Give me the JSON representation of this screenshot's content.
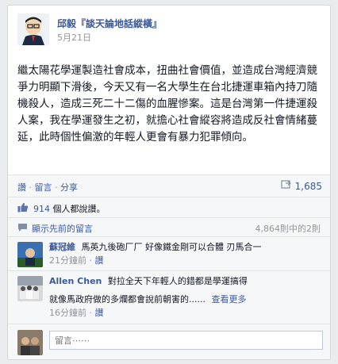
{
  "post": {
    "author": "邱毅『談天論地話縱橫』",
    "timestamp": "5月21日",
    "body": "繼太陽花學運製造社會成本，扭曲社會價值，並造成台灣經濟競爭力明顯下滑後，今天又有一名大學生在台北捷運車箱內持刀隨機殺人，造成三死二十二傷的血腥慘案。這是台灣第一件捷運殺人案，我在學運發生之初，就擔心社會縱容將造成反社會情緒蔓延，此時個性偏激的年輕人更會有暴力犯罪傾向。"
  },
  "actions": {
    "like": "讚",
    "comment": "留言",
    "share": "分享",
    "share_count": "1,685"
  },
  "likes": {
    "count": "914",
    "suffix": "個人都說讚。"
  },
  "previous_comments": {
    "label": "顯示先前的留言",
    "count": "4,864則中的2則"
  },
  "comments": [
    {
      "name": "蘇冠維",
      "text": "馬英九後砲厂厂 好像鐵金剛可以合體 刃馬合一",
      "time": "21分鐘前",
      "like": "讚"
    },
    {
      "name": "Allen Chen",
      "text": "對拉全天下年輕人的錯都是學運搞得",
      "text2": "就像馬政府做的多爛都會說前朝害的......",
      "see_more": "查看更多",
      "time": "16分鐘前",
      "like": "讚"
    }
  ],
  "comment_input": {
    "placeholder": "留言⋯⋯"
  },
  "colors": {
    "link": "#3b5998",
    "background": "#e9ebee"
  }
}
